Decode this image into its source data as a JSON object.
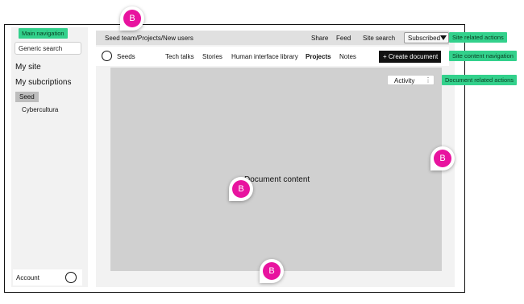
{
  "sidebar": {
    "search_value": "Generic search",
    "links": [
      "My site",
      "My subcriptions"
    ],
    "items": [
      "Seed",
      "Cybercultura"
    ],
    "account_label": "Account"
  },
  "topbar": {
    "breadcrumb": "Seed team/Projects/New users",
    "links": [
      "Share",
      "Feed",
      "Site search"
    ],
    "subscribe_label": "Subscribed"
  },
  "subnav": {
    "site_name": "Seeds",
    "links": [
      "Tech talks",
      "Stories",
      "Human interface library",
      "Projects",
      "Notes"
    ],
    "active": "Projects",
    "create_label": "+ Create document"
  },
  "document": {
    "activity_label": "Activity",
    "content_text": "Document content"
  },
  "annotations": {
    "main_navigation": "Main navigation",
    "site_related_actions": "Site related actions",
    "site_content_navigation": "Site content navigation",
    "document_related_actions": "Document related actions"
  },
  "collaborators": [
    "B",
    "B",
    "B",
    "B"
  ],
  "colors": {
    "annotation": "#33d18c",
    "avatar": "#e8139f"
  }
}
